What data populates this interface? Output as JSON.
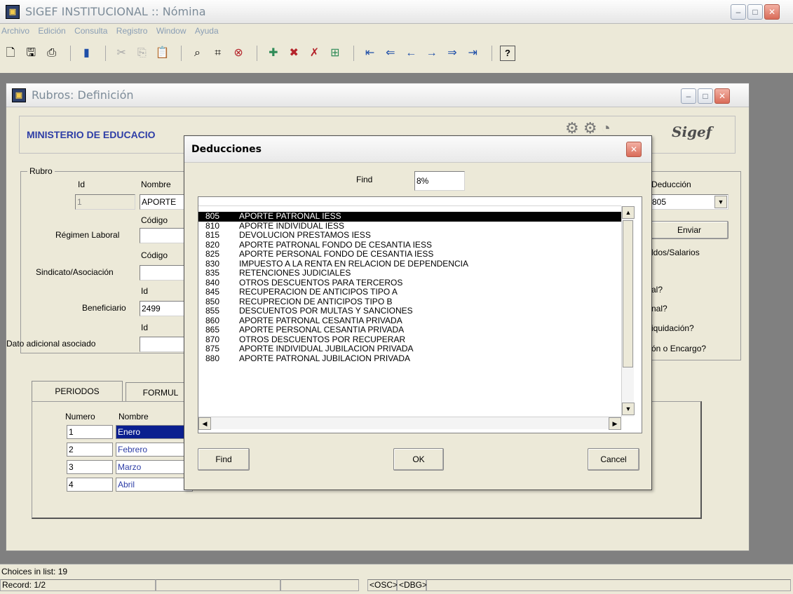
{
  "app": {
    "title": "SIGEF INSTITUCIONAL :: Nómina",
    "menu": [
      "Archivo",
      "Edición",
      "Consulta",
      "Registro",
      "Window",
      "Ayuda"
    ]
  },
  "child": {
    "title": "Rubros: Definición",
    "ministry": "MINISTERIO DE EDUCACIO",
    "logo": "Sigef"
  },
  "rubro": {
    "group_label": "Rubro",
    "id_label": "Id",
    "id_value": "1",
    "nombre_label": "Nombre",
    "nombre_value": "APORTE",
    "codigo_label_1": "Código",
    "regimen_label": "Régimen Laboral",
    "codigo_label_2": "Código",
    "sindicato_label": "Sindicato/Asociación",
    "id_label_2": "Id",
    "beneficiario_label": "Beneficiario",
    "beneficiario_value": "2499",
    "id_label_3": "Id",
    "dato_label": "Dato adicional asociado"
  },
  "right_panel": {
    "deduccion_label": "Deducción",
    "deduccion_value": "805",
    "enviar": "Enviar",
    "sueldos": "ldos/Salarios",
    "q1": "al?",
    "q2": "nal?",
    "q3": "iquidación?",
    "q4": "ón o Encargo?"
  },
  "tabs": {
    "periodos": "PERIODOS",
    "formulas": "FORMUL"
  },
  "periodos": {
    "numero_label": "Numero",
    "nombre_label": "Nombre",
    "rows": [
      {
        "num": "1",
        "name": "Enero"
      },
      {
        "num": "2",
        "name": "Febrero"
      },
      {
        "num": "3",
        "name": "Marzo"
      },
      {
        "num": "4",
        "name": "Abril"
      }
    ]
  },
  "status": {
    "choices": "Choices in list: 19",
    "record": "Record: 1/2",
    "osc": "<OSC>",
    "dbg": "<DBG>"
  },
  "dialog": {
    "title": "Deducciones",
    "find_label": "Find",
    "find_value": "8%",
    "items": [
      {
        "code": "805",
        "desc": "APORTE PATRONAL IESS"
      },
      {
        "code": "810",
        "desc": "APORTE INDIVIDUAL IESS"
      },
      {
        "code": "815",
        "desc": "DEVOLUCION PRESTAMOS IESS"
      },
      {
        "code": "820",
        "desc": "APORTE PATRONAL FONDO DE CESANTIA IESS"
      },
      {
        "code": "825",
        "desc": "APORTE PERSONAL FONDO DE CESANTIA IESS"
      },
      {
        "code": "830",
        "desc": "IMPUESTO A LA RENTA EN RELACION DE DEPENDENCIA"
      },
      {
        "code": "835",
        "desc": "RETENCIONES JUDICIALES"
      },
      {
        "code": "840",
        "desc": "OTROS DESCUENTOS PARA TERCEROS"
      },
      {
        "code": "845",
        "desc": "RECUPERACION DE ANTICIPOS TIPO A"
      },
      {
        "code": "850",
        "desc": "RECUPRECION DE ANTICIPOS TIPO B"
      },
      {
        "code": "855",
        "desc": "DESCUENTOS POR MULTAS Y SANCIONES"
      },
      {
        "code": "860",
        "desc": "APORTE PATRONAL CESANTIA PRIVADA"
      },
      {
        "code": "865",
        "desc": "APORTE PERSONAL CESANTIA PRIVADA"
      },
      {
        "code": "870",
        "desc": "OTROS DESCUENTOS POR RECUPERAR"
      },
      {
        "code": "875",
        "desc": "APORTE INDIVIDUAL JUBILACION PRIVADA"
      },
      {
        "code": "880",
        "desc": "APORTE PATRONAL JUBILACION PRIVADA"
      }
    ],
    "find_button": "Find",
    "ok_button": "OK",
    "cancel_button": "Cancel"
  }
}
